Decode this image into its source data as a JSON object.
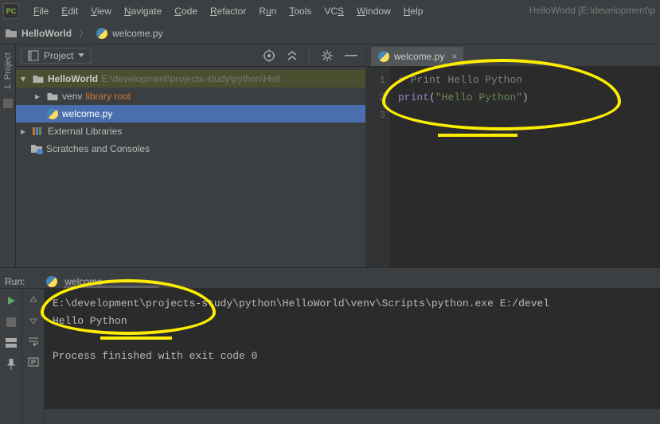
{
  "menubar": {
    "items": [
      "File",
      "Edit",
      "View",
      "Navigate",
      "Code",
      "Refactor",
      "Run",
      "Tools",
      "VCS",
      "Window",
      "Help"
    ],
    "title": "HelloWorld [E:\\development\\p"
  },
  "nav": {
    "crumb1": "HelloWorld",
    "crumb2": "welcome.py"
  },
  "leftRail": {
    "label": "1: Project"
  },
  "projectHeader": {
    "label": "Project"
  },
  "tree": {
    "root": {
      "name": "HelloWorld",
      "path": "E:\\development\\projects-study\\python\\Hell"
    },
    "venv": {
      "name": "venv",
      "hint": "library root"
    },
    "file": {
      "name": "welcome.py"
    },
    "external": "External Libraries",
    "scratches": "Scratches and Consoles"
  },
  "editor": {
    "tab": "welcome.py",
    "lines": [
      "1",
      "2",
      "3"
    ],
    "code": {
      "l1": "# Print Hello Python",
      "l2a": "print",
      "l2b": "(",
      "l2c": "\"Hello Python\"",
      "l2d": ")"
    }
  },
  "run": {
    "label": "Run:",
    "config": "welcome",
    "out1": "E:\\development\\projects-study\\python\\HelloWorld\\venv\\Scripts\\python.exe E:/devel",
    "out2": "Hello Python",
    "out3": "Process finished with exit code 0"
  }
}
